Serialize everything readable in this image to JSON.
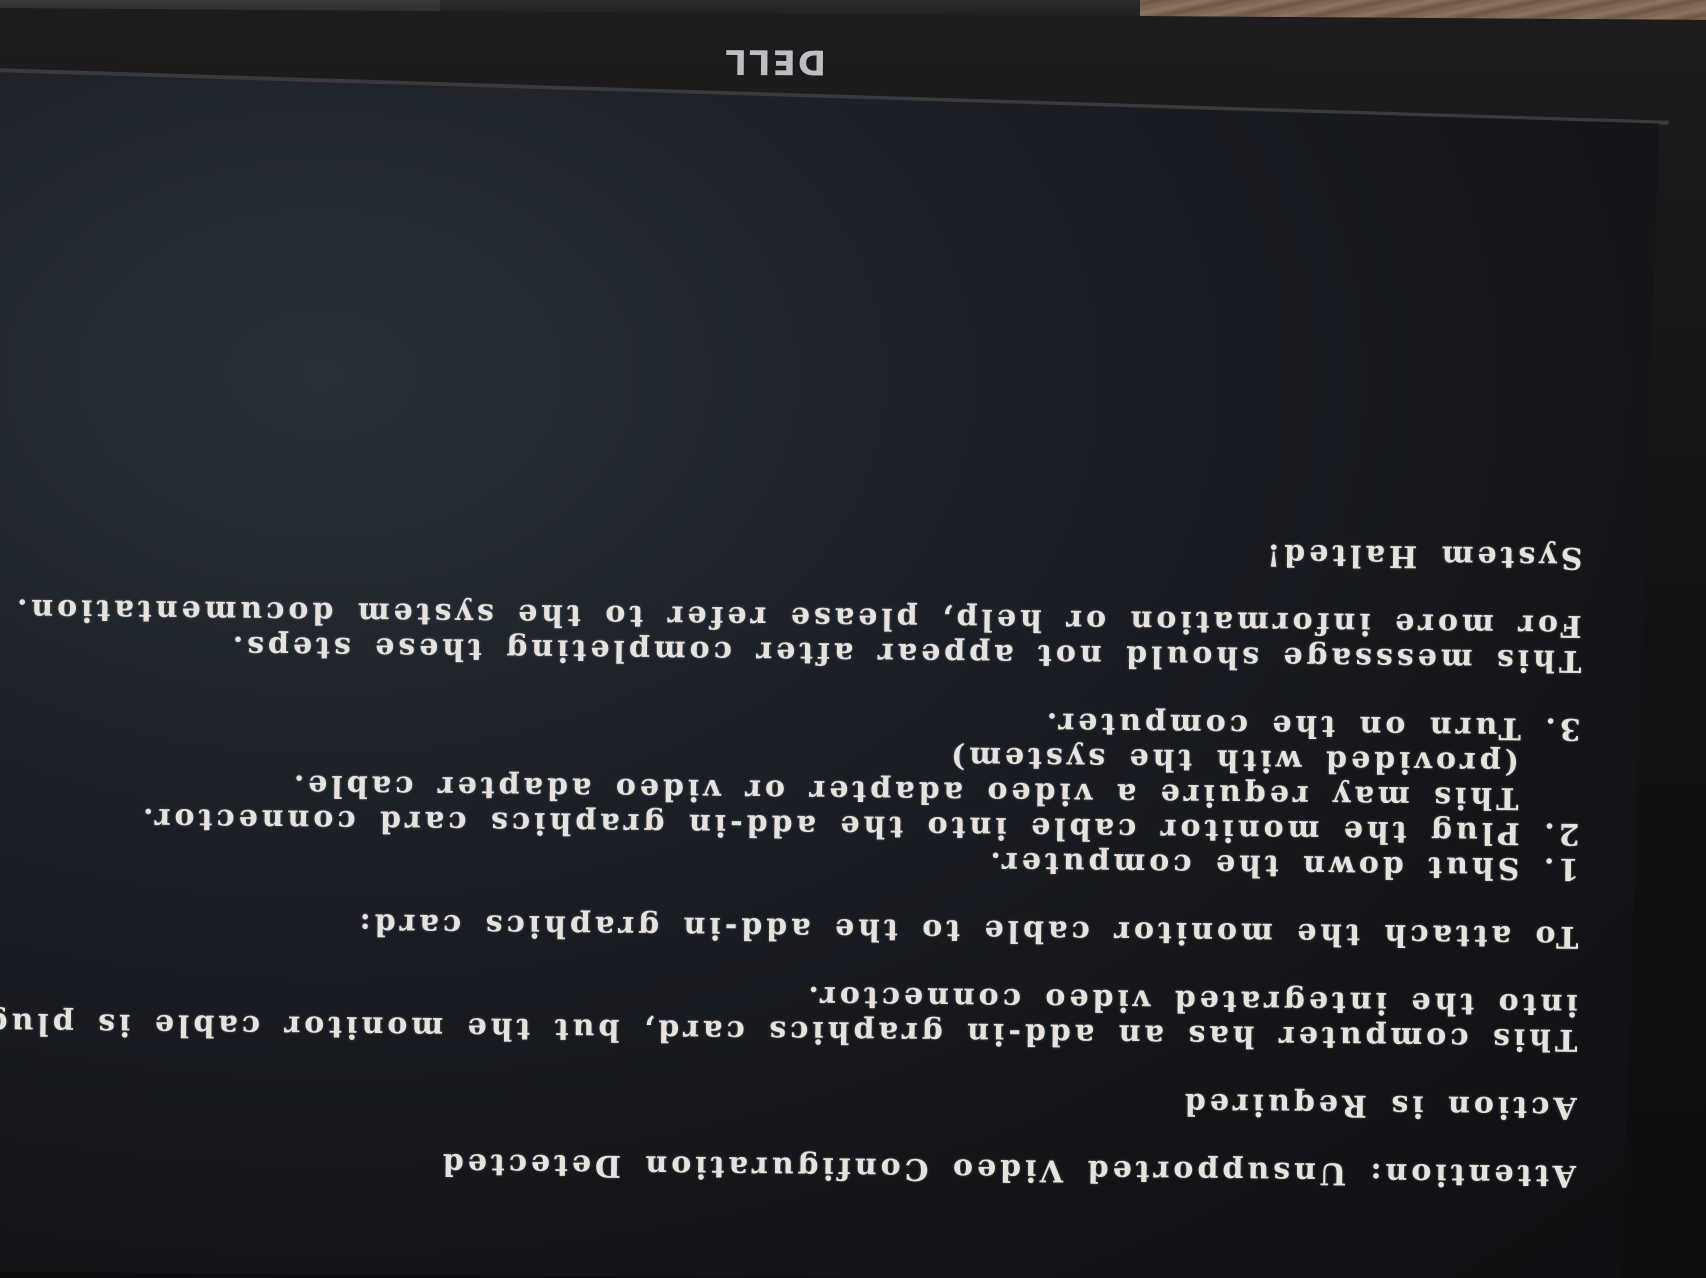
{
  "monitor": {
    "brand_logo": "DELL"
  },
  "screen": {
    "title": "Attention: Unsupported Video Configuration Detected",
    "subtitle": "Action is Required",
    "paragraph1": [
      "This computer has an add-in graphics card, but the monitor cable is plugged",
      "into the integrated video connector."
    ],
    "instructions_heading": "To attach the monitor cable to the add-in graphics card:",
    "steps": [
      "1. Shut down the computer.",
      "2. Plug the monitor cable into the add-in graphics card connector.",
      "   This may require a video adapter or video adapter cable.",
      "   (provided with the system)",
      "3. Turn on the computer."
    ],
    "paragraph2": [
      "This messsage should not appear after completing these steps.",
      "For more information or help, please refer to the system documentation."
    ],
    "status": "System Halted!"
  }
}
